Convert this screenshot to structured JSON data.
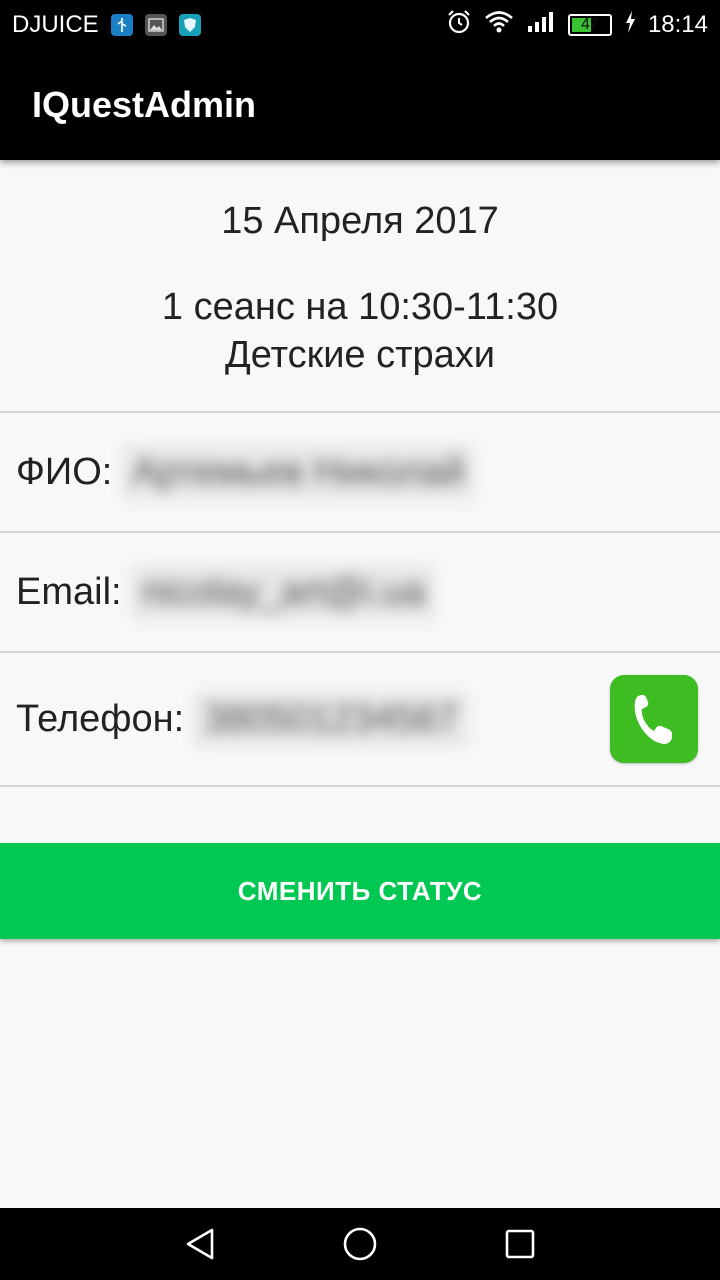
{
  "status_bar": {
    "carrier": "DJUICE",
    "battery_level": "47",
    "time": "18:14",
    "icons": [
      "usb-icon",
      "image-icon",
      "shield-icon",
      "alarm-icon",
      "wifi-icon",
      "signal-icon",
      "battery-icon",
      "charging-icon"
    ]
  },
  "app_bar": {
    "title": "IQuestAdmin"
  },
  "booking": {
    "date": "15 Апреля 2017",
    "session": "1 сеанс на 10:30-11:30",
    "quest_name": "Детские страхи"
  },
  "fields": {
    "name_label": "ФИО:",
    "name_value": "Артемьев Николай",
    "email_label": "Email:",
    "email_value": "nicolay_art@i.ua",
    "phone_label": "Телефон:",
    "phone_value": "380501234567"
  },
  "actions": {
    "change_status_label": "СМЕНИТЬ СТАТУС",
    "call_icon": "phone-icon"
  },
  "colors": {
    "app_bar": "#000000",
    "accent_green": "#00c853",
    "call_green": "#3ebd22",
    "background": "#f8f8f8"
  }
}
